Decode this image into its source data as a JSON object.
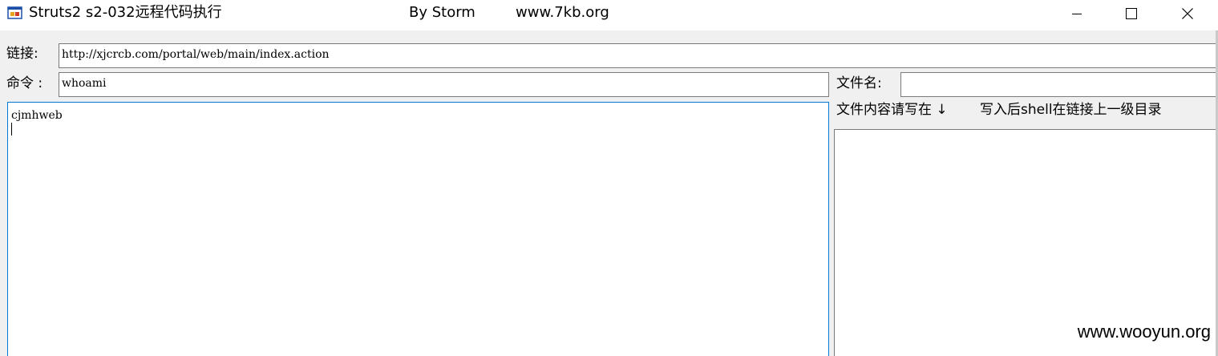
{
  "window": {
    "title": "Struts2 s2-032远程代码执行",
    "author": "By Storm",
    "site": "www.7kb.org",
    "icon": "app-window-icon",
    "controls": [
      "minimize-icon",
      "maximize-icon",
      "close-icon"
    ]
  },
  "form": {
    "url_label": "链接:",
    "url_value": "http://xjcrcb.com/portal/web/main/index.action",
    "command_label": "命令 :",
    "command_value": "whoami",
    "filename_label": "文件名:",
    "filename_value": "",
    "file_content_hint": "文件内容请写在 ↓",
    "shell_note": "写入后shell在链接上一级目录"
  },
  "output": {
    "text": "cjmhweb"
  },
  "watermark": "www.wooyun.org",
  "colors": {
    "focus_border": "#0078d7",
    "field_border": "#7a7a7a",
    "client_bg": "#f0f0f0"
  }
}
